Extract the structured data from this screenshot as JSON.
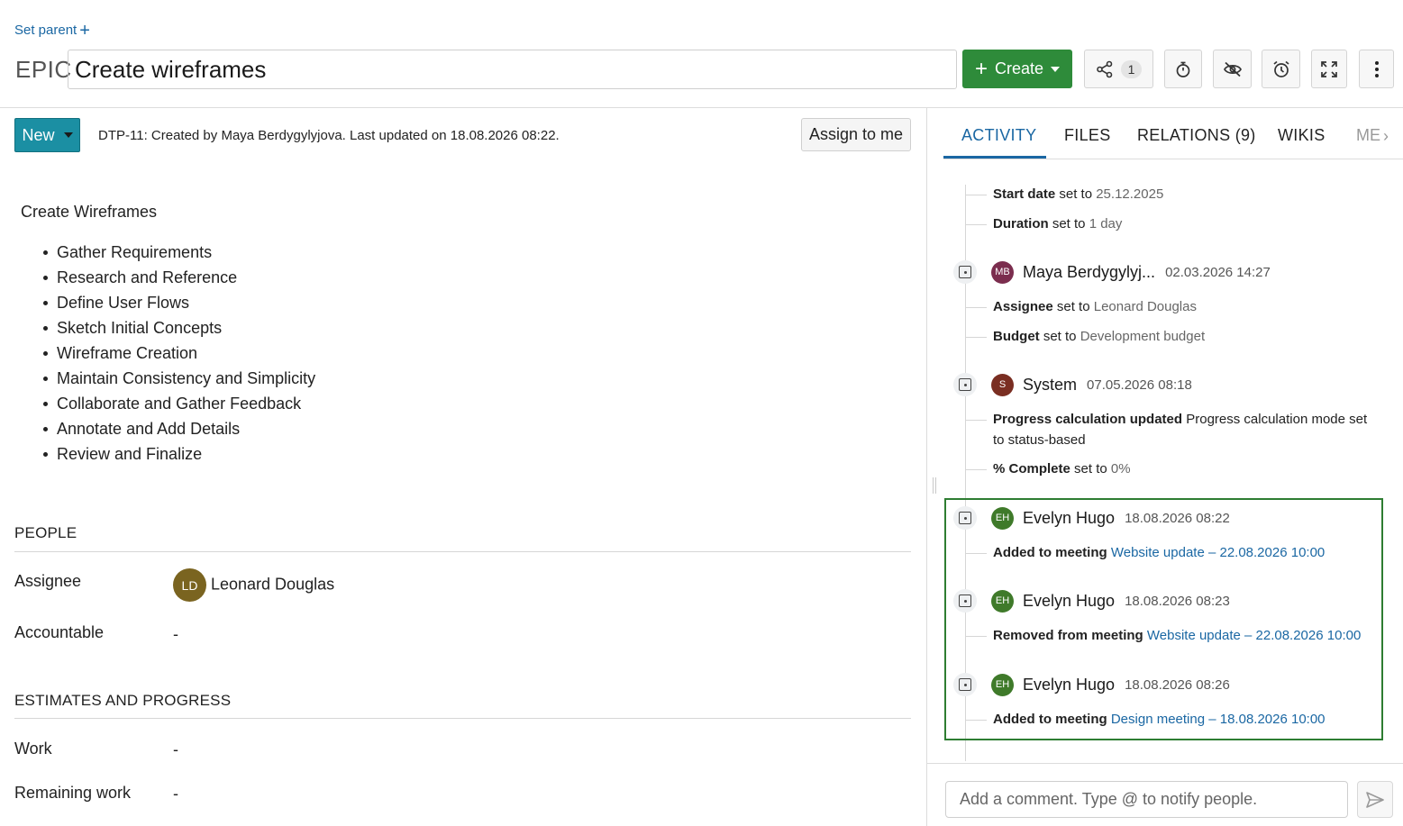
{
  "header": {
    "set_parent_label": "Set parent",
    "type_label": "EPIC",
    "title": "Create wireframes",
    "create_label": "Create",
    "share_count": "1"
  },
  "status_bar": {
    "status": "New",
    "meta": "DTP-11: Created by Maya Berdygylyjova. Last updated on 18.08.2026 08:22.",
    "assign_label": "Assign to me"
  },
  "description": {
    "heading": "Create Wireframes",
    "items": [
      "Gather Requirements",
      "Research and Reference",
      "Define User Flows",
      "Sketch Initial Concepts",
      "Wireframe Creation",
      "Maintain Consistency and Simplicity",
      "Collaborate and Gather Feedback",
      "Annotate and Add Details",
      "Review and Finalize"
    ]
  },
  "people": {
    "title": "PEOPLE",
    "assignee_label": "Assignee",
    "assignee_initials": "LD",
    "assignee_name": "Leonard Douglas",
    "accountable_label": "Accountable",
    "accountable_value": "-"
  },
  "estimates": {
    "title": "ESTIMATES AND PROGRESS",
    "work_label": "Work",
    "work_value": "-",
    "remaining_label": "Remaining work",
    "remaining_value": "-"
  },
  "tabs": {
    "activity": "ACTIVITY",
    "files": "FILES",
    "relations": "RELATIONS (9)",
    "wikis": "WIKIS",
    "more": "ME"
  },
  "activity": {
    "d1_field": "Start date",
    "d1_mid": " set to ",
    "d1_value": "25.12.2025",
    "d2_field": "Duration",
    "d2_mid": " set to ",
    "d2_value": "1 day",
    "e1_initials": "MB",
    "e1_user": "Maya Berdygylyj...",
    "e1_time": "02.03.2026 14:27",
    "e1_color": "#7b2d4e",
    "d3_field": "Assignee",
    "d3_mid": " set to ",
    "d3_value": "Leonard Douglas",
    "d4_field": "Budget",
    "d4_mid": " set to ",
    "d4_value": "Development budget",
    "e2_initials": "S",
    "e2_user": "System",
    "e2_time": "07.05.2026 08:18",
    "e2_color": "#7a2e22",
    "d5_field": "Progress calculation updated",
    "d5_rest": " Progress calculation mode set to status-based",
    "d6_field": "% Complete",
    "d6_mid": " set to ",
    "d6_value": "0%",
    "e3_initials": "EH",
    "e3_user": "Evelyn Hugo",
    "e3_time": "18.08.2026 08:22",
    "e3_color": "#3f7a2a",
    "d7_field": "Added to meeting",
    "d7_link": "Website update – 22.08.2026 10:00",
    "e4_initials": "EH",
    "e4_user": "Evelyn Hugo",
    "e4_time": "18.08.2026 08:23",
    "d8_field": "Removed from meeting",
    "d8_link": "Website update – 22.08.2026 10:00",
    "e5_initials": "EH",
    "e5_user": "Evelyn Hugo",
    "e5_time": "18.08.2026 08:26",
    "d9_field": "Added to meeting",
    "d9_link": "Design meeting – 18.08.2026 10:00"
  },
  "comment": {
    "placeholder": "Add a comment. Type @ to notify people."
  },
  "colors": {
    "brand_blue": "#1a67a3",
    "create_green": "#2e8b3a",
    "status_teal": "#1b8fa3",
    "highlight_green": "#2e7d32"
  }
}
